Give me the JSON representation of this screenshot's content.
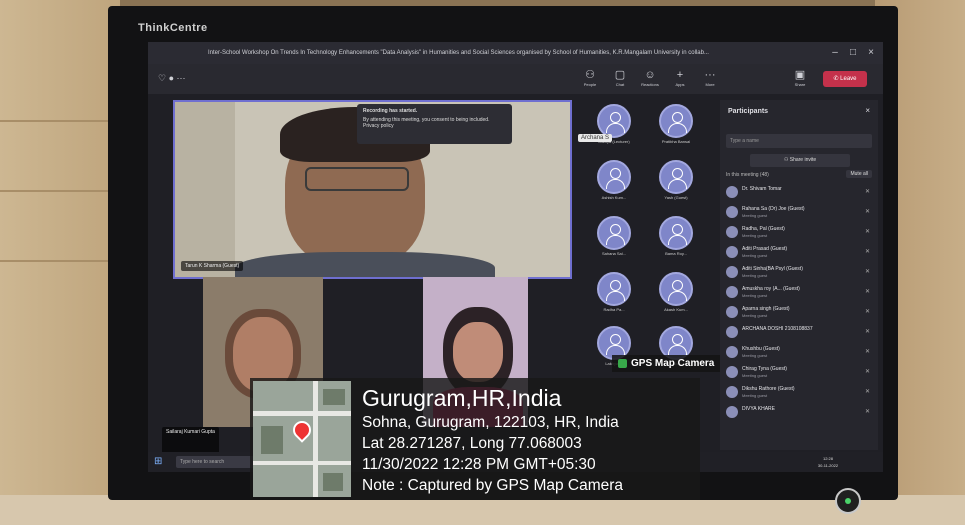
{
  "brand": "ThinkCentre",
  "window": {
    "title": "Inter-School Workshop On Trends In Technology Enhancements \"Data Analysis\" in Humanities and Social Sciences organised by School of Humanities, K.R.Mangalam University in collab..."
  },
  "toolbar": {
    "items": [
      {
        "label": "People",
        "icon": "people-icon"
      },
      {
        "label": "Chat",
        "icon": "chat-icon"
      },
      {
        "label": "Reactions",
        "icon": "reactions-icon"
      },
      {
        "label": "Apps",
        "icon": "apps-icon"
      },
      {
        "label": "More",
        "icon": "more-icon"
      },
      {
        "label": "Share",
        "icon": "share-icon"
      }
    ],
    "leave_label": "Leave"
  },
  "main_video": {
    "name": "Tarun K Sharma (Guest)",
    "recording_title": "Recording has started.",
    "recording_body": "By attending this meeting, you consent to being included. Privacy policy"
  },
  "tiles": {
    "highlight": "Archana S",
    "names": [
      "Lakhya (Lecturer)",
      "Pratibha Bansal",
      "Ashish Kum...",
      "Yash (Guest)",
      "Sahana Sal...",
      "Bama Roy...",
      "Radha Pa...",
      "Akash Kum...",
      "Lakhya ...",
      "Lbr"
    ]
  },
  "videos": {
    "bottom_left_name": "Sailaraj Kumari Gupta"
  },
  "panel": {
    "title": "Participants",
    "search_placeholder": "Type a name",
    "share_label": "Share invite",
    "section_label": "In this meeting (48)",
    "mute_all": "Mute all",
    "people": [
      {
        "name": "Dr. Shivam Tomar",
        "role": ""
      },
      {
        "name": "Rahana Sa (Dr) Joe (Guest)",
        "role": "Meeting guest"
      },
      {
        "name": "Radha, Pal (Guest)",
        "role": "Meeting guest"
      },
      {
        "name": "Aditi Prasad (Guest)",
        "role": "Meeting guest"
      },
      {
        "name": "Aditi Sinha(BA Psyl (Guest)",
        "role": "Meeting guest"
      },
      {
        "name": "Amuskha roy (A... (Guest)",
        "role": "Meeting guest"
      },
      {
        "name": "Aparna singh (Guest)",
        "role": "Meeting guest"
      },
      {
        "name": "ARCHANA DOSHI 2108108837",
        "role": ""
      },
      {
        "name": "Khushbu (Guest)",
        "role": "Meeting guest"
      },
      {
        "name": "Chirag Tyna (Guest)",
        "role": "Meeting guest"
      },
      {
        "name": "Dikshu Rathore (Guest)",
        "role": "Meeting guest"
      },
      {
        "name": "DIVYA KHARE",
        "role": ""
      }
    ]
  },
  "taskbar": {
    "search_placeholder": "Type here to search",
    "time": "12:28",
    "date": "30-11-2022"
  },
  "gps": {
    "app_label": "GPS Map Camera",
    "city": "Gurugram,HR,India",
    "address": "Sohna, Gurugram, 122103, HR, India",
    "coords": "Lat 28.271287, Long 77.068003",
    "timestamp": "11/30/2022 12:28 PM GMT+05:30",
    "note": "Note : Captured by GPS Map Camera"
  },
  "colors": {
    "accent": "#6f6fd0",
    "leave": "#c4314b",
    "gps_badge": "#38a84a"
  }
}
